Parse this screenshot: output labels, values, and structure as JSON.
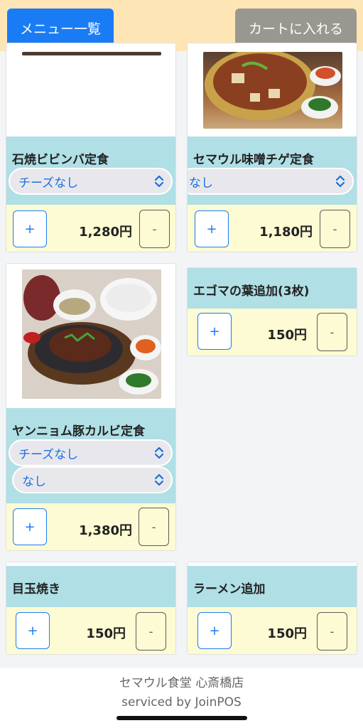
{
  "header": {
    "menu_list_label": "メニュー一覧",
    "add_to_cart_label": "カートに入れる"
  },
  "items": [
    {
      "name": "石焼ビビンバ定食",
      "options": [
        "チーズなし"
      ],
      "price": "1,280円",
      "plus": "+",
      "minus": "-"
    },
    {
      "name": "セマウル味噌チゲ定食",
      "options": [
        "なし"
      ],
      "price": "1,180円",
      "plus": "+",
      "minus": "-"
    },
    {
      "name": "ヤンニョム豚カルビ定食",
      "options": [
        "チーズなし",
        "なし"
      ],
      "price": "1,380円",
      "plus": "+",
      "minus": "-"
    },
    {
      "name": "エゴマの葉追加(3枚)",
      "price": "150円",
      "plus": "+",
      "minus": "-"
    },
    {
      "name": "目玉焼き",
      "price": "150円",
      "plus": "+",
      "minus": "-"
    },
    {
      "name": "ラーメン追加",
      "price": "150円",
      "plus": "+",
      "minus": "-"
    }
  ],
  "footer": {
    "store_name": "セマウル食堂 心斎橋店",
    "serviced_by": "serviced by JoinPOS"
  },
  "colors": {
    "primary_blue": "#1a7cf5",
    "cart_gray": "#999890",
    "topbar_bg": "#fde5b5",
    "name_bg": "#b0dfe6",
    "price_bg": "#fdfbd3"
  }
}
